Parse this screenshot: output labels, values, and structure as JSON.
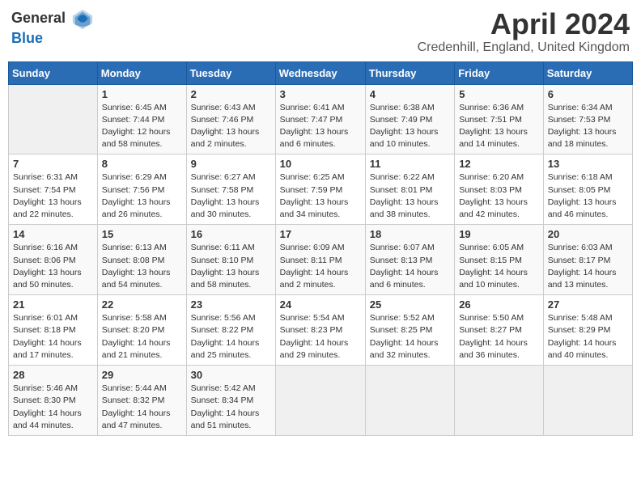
{
  "logo": {
    "general": "General",
    "blue": "Blue"
  },
  "title": "April 2024",
  "subtitle": "Credenhill, England, United Kingdom",
  "weekdays": [
    "Sunday",
    "Monday",
    "Tuesday",
    "Wednesday",
    "Thursday",
    "Friday",
    "Saturday"
  ],
  "weeks": [
    [
      {
        "day": "",
        "empty": true
      },
      {
        "day": "1",
        "sunrise": "6:45 AM",
        "sunset": "7:44 PM",
        "daylight": "12 hours and 58 minutes."
      },
      {
        "day": "2",
        "sunrise": "6:43 AM",
        "sunset": "7:46 PM",
        "daylight": "13 hours and 2 minutes."
      },
      {
        "day": "3",
        "sunrise": "6:41 AM",
        "sunset": "7:47 PM",
        "daylight": "13 hours and 6 minutes."
      },
      {
        "day": "4",
        "sunrise": "6:38 AM",
        "sunset": "7:49 PM",
        "daylight": "13 hours and 10 minutes."
      },
      {
        "day": "5",
        "sunrise": "6:36 AM",
        "sunset": "7:51 PM",
        "daylight": "13 hours and 14 minutes."
      },
      {
        "day": "6",
        "sunrise": "6:34 AM",
        "sunset": "7:53 PM",
        "daylight": "13 hours and 18 minutes."
      }
    ],
    [
      {
        "day": "7",
        "sunrise": "6:31 AM",
        "sunset": "7:54 PM",
        "daylight": "13 hours and 22 minutes."
      },
      {
        "day": "8",
        "sunrise": "6:29 AM",
        "sunset": "7:56 PM",
        "daylight": "13 hours and 26 minutes."
      },
      {
        "day": "9",
        "sunrise": "6:27 AM",
        "sunset": "7:58 PM",
        "daylight": "13 hours and 30 minutes."
      },
      {
        "day": "10",
        "sunrise": "6:25 AM",
        "sunset": "7:59 PM",
        "daylight": "13 hours and 34 minutes."
      },
      {
        "day": "11",
        "sunrise": "6:22 AM",
        "sunset": "8:01 PM",
        "daylight": "13 hours and 38 minutes."
      },
      {
        "day": "12",
        "sunrise": "6:20 AM",
        "sunset": "8:03 PM",
        "daylight": "13 hours and 42 minutes."
      },
      {
        "day": "13",
        "sunrise": "6:18 AM",
        "sunset": "8:05 PM",
        "daylight": "13 hours and 46 minutes."
      }
    ],
    [
      {
        "day": "14",
        "sunrise": "6:16 AM",
        "sunset": "8:06 PM",
        "daylight": "13 hours and 50 minutes."
      },
      {
        "day": "15",
        "sunrise": "6:13 AM",
        "sunset": "8:08 PM",
        "daylight": "13 hours and 54 minutes."
      },
      {
        "day": "16",
        "sunrise": "6:11 AM",
        "sunset": "8:10 PM",
        "daylight": "13 hours and 58 minutes."
      },
      {
        "day": "17",
        "sunrise": "6:09 AM",
        "sunset": "8:11 PM",
        "daylight": "14 hours and 2 minutes."
      },
      {
        "day": "18",
        "sunrise": "6:07 AM",
        "sunset": "8:13 PM",
        "daylight": "14 hours and 6 minutes."
      },
      {
        "day": "19",
        "sunrise": "6:05 AM",
        "sunset": "8:15 PM",
        "daylight": "14 hours and 10 minutes."
      },
      {
        "day": "20",
        "sunrise": "6:03 AM",
        "sunset": "8:17 PM",
        "daylight": "14 hours and 13 minutes."
      }
    ],
    [
      {
        "day": "21",
        "sunrise": "6:01 AM",
        "sunset": "8:18 PM",
        "daylight": "14 hours and 17 minutes."
      },
      {
        "day": "22",
        "sunrise": "5:58 AM",
        "sunset": "8:20 PM",
        "daylight": "14 hours and 21 minutes."
      },
      {
        "day": "23",
        "sunrise": "5:56 AM",
        "sunset": "8:22 PM",
        "daylight": "14 hours and 25 minutes."
      },
      {
        "day": "24",
        "sunrise": "5:54 AM",
        "sunset": "8:23 PM",
        "daylight": "14 hours and 29 minutes."
      },
      {
        "day": "25",
        "sunrise": "5:52 AM",
        "sunset": "8:25 PM",
        "daylight": "14 hours and 32 minutes."
      },
      {
        "day": "26",
        "sunrise": "5:50 AM",
        "sunset": "8:27 PM",
        "daylight": "14 hours and 36 minutes."
      },
      {
        "day": "27",
        "sunrise": "5:48 AM",
        "sunset": "8:29 PM",
        "daylight": "14 hours and 40 minutes."
      }
    ],
    [
      {
        "day": "28",
        "sunrise": "5:46 AM",
        "sunset": "8:30 PM",
        "daylight": "14 hours and 44 minutes."
      },
      {
        "day": "29",
        "sunrise": "5:44 AM",
        "sunset": "8:32 PM",
        "daylight": "14 hours and 47 minutes."
      },
      {
        "day": "30",
        "sunrise": "5:42 AM",
        "sunset": "8:34 PM",
        "daylight": "14 hours and 51 minutes."
      },
      {
        "day": "",
        "empty": true
      },
      {
        "day": "",
        "empty": true
      },
      {
        "day": "",
        "empty": true
      },
      {
        "day": "",
        "empty": true
      }
    ]
  ]
}
